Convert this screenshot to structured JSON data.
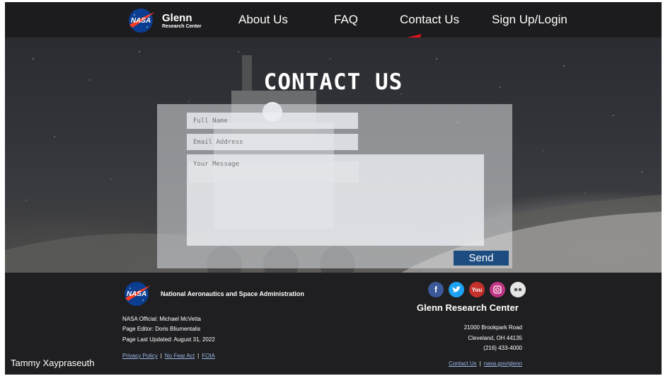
{
  "header": {
    "brand_name": "Glenn",
    "brand_sub": "Research Center",
    "nav": [
      "About Us",
      "FAQ",
      "Contact Us",
      "Sign Up/Login"
    ]
  },
  "hero": {
    "title": "CONTACT US",
    "form": {
      "name_placeholder": "Full Name",
      "email_placeholder": "Email Address",
      "message_placeholder": "Your Message",
      "send_label": "Send"
    }
  },
  "footer": {
    "agency": "National Aeronautics and Space Administration",
    "official": "NASA Official: Michael McVetta",
    "editor": "Page Editor: Doris Bliumentalis",
    "updated": "Page Last Updated: August 31, 2022",
    "links": [
      "Privacy Policy",
      "No Fear Act",
      "FOIA"
    ],
    "center_name": "Glenn Research Center",
    "address_line1": "21000 Brookpark Road",
    "address_line2": "Cleveland, OH 44135",
    "phone": "(216) 433-4000",
    "right_links": [
      "Contact Us",
      "nasa.gov/glenn"
    ],
    "author": "Tammy Xaypraseuth",
    "social_icons": [
      "facebook-icon",
      "twitter-icon",
      "youtube-icon",
      "instagram-icon",
      "flickr-icon"
    ],
    "youtube_text": "You"
  },
  "colors": {
    "header_bg": "#1c1c1e",
    "footer_bg": "#1f1f21",
    "send_button": "#1d4c80",
    "arrow": "#e8101a",
    "link": "#9ab8e6"
  }
}
